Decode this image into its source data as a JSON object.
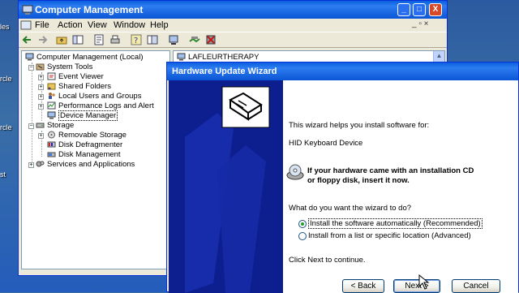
{
  "desktop": {
    "labels": [
      "les",
      "rcle",
      "rcle",
      "st"
    ]
  },
  "cm_window": {
    "title": "Computer Management",
    "controls": {
      "minimize": "_",
      "maximize": "□",
      "close": "X"
    },
    "menu": [
      "File",
      "Action",
      "View",
      "Window",
      "Help"
    ],
    "mdi_controls": "_ ▫ ×",
    "tree": {
      "root": "Computer Management (Local)",
      "system_tools": "System Tools",
      "event_viewer": "Event Viewer",
      "shared_folders": "Shared Folders",
      "local_users": "Local Users and Groups",
      "perf_logs": "Performance Logs and Alert",
      "device_manager": "Device Manager",
      "storage": "Storage",
      "removable_storage": "Removable Storage",
      "disk_defragmenter": "Disk Defragmenter",
      "disk_management": "Disk Management",
      "services": "Services and Applications"
    },
    "right_pane": {
      "computer_name": "LAFLEURTHERAPY"
    },
    "colors": {
      "title_bar": "#0a5fde",
      "window_bg": "#ece9d8"
    }
  },
  "wizard": {
    "title": "Hardware Update Wizard",
    "intro": "This wizard helps you install software for:",
    "device": "HID Keyboard Device",
    "cd_line1": "If your hardware came with an installation CD",
    "cd_line2": "or floppy disk, insert it now.",
    "question": "What do you want the wizard to do?",
    "options": [
      {
        "label": "Install the software automatically (Recommended)",
        "checked": true
      },
      {
        "label": "Install from a list or specific location (Advanced)",
        "checked": false
      }
    ],
    "footer": "Click Next to continue.",
    "buttons": {
      "back": "< Back",
      "next": "Next >",
      "cancel": "Cancel"
    },
    "colors": {
      "left_panel": "#0d1e8f"
    }
  }
}
